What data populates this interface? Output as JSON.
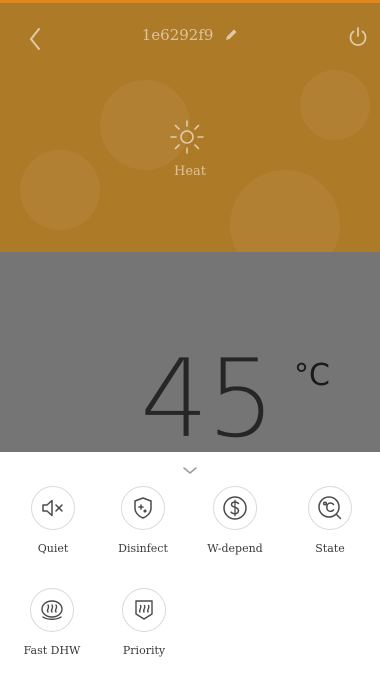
{
  "header": {
    "device_name": "1e6292f9",
    "mode_label": "Heat",
    "icons": {
      "back": "chevron-left-icon",
      "edit": "pencil-icon",
      "power": "power-icon",
      "mode": "sun-icon"
    },
    "background_color": "#ad7a27"
  },
  "temperature": {
    "value": "45",
    "unit": "°C"
  },
  "sheet": {
    "collapse_icon": "chevron-down-icon",
    "functions": [
      {
        "label": "Quiet",
        "icon": "speaker-mute-icon"
      },
      {
        "label": "Disinfect",
        "icon": "shield-plus-icon"
      },
      {
        "label": "W-depend",
        "icon": "dollar-circle-icon"
      },
      {
        "label": "State",
        "icon": "temperature-state-icon"
      },
      {
        "label": "Fast DHW",
        "icon": "fast-heat-icon"
      },
      {
        "label": "Priority",
        "icon": "priority-heat-icon"
      }
    ]
  },
  "colors": {
    "accent_line": "#e6841c",
    "temp_panel": "#757575",
    "icon_stroke": "#4a4a4a"
  }
}
